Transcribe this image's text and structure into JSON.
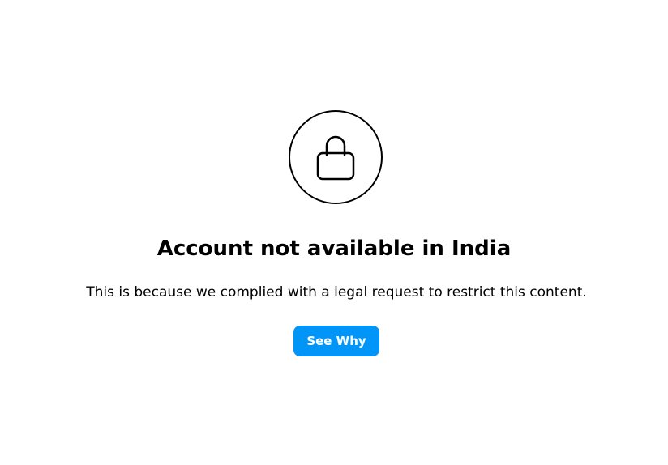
{
  "icon": "lock-icon",
  "title": "Account not available in India",
  "message": "This is because we complied with a legal request to restrict this content.",
  "button": {
    "label": "See Why",
    "color": "#0095f6",
    "text_color": "#ffffff"
  }
}
